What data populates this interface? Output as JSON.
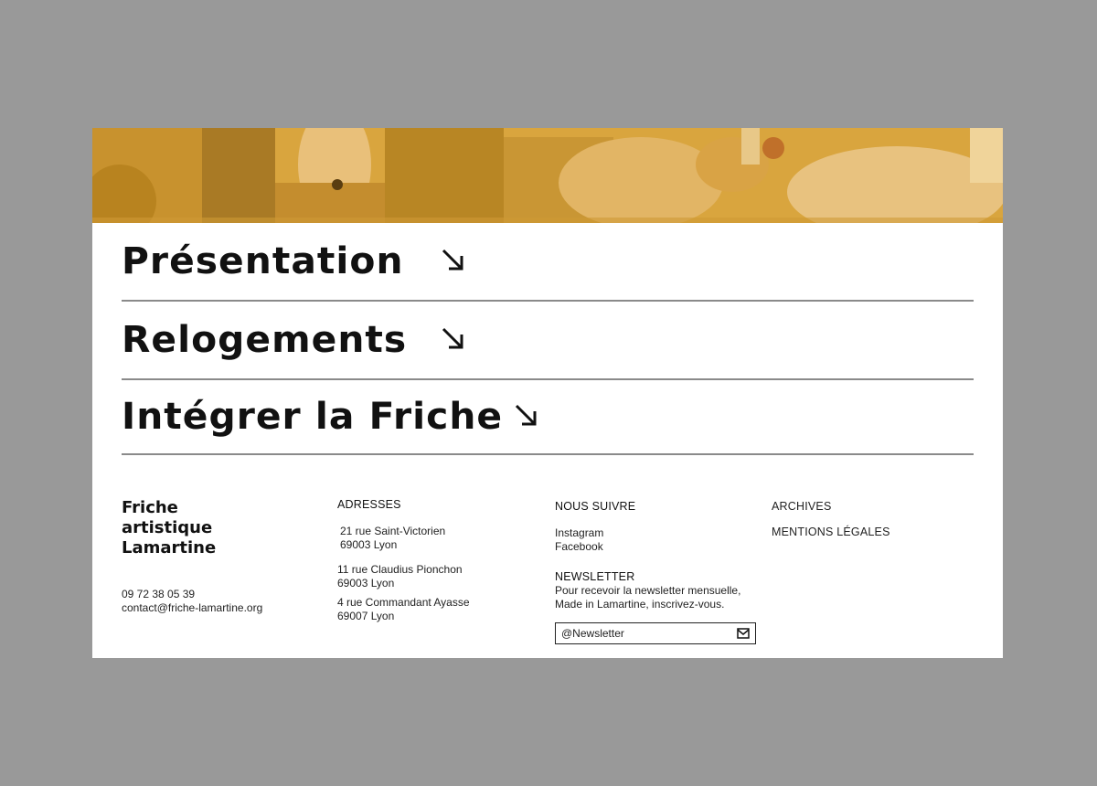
{
  "colors": {
    "page_background": "#999999",
    "panel_background": "#ffffff",
    "hero_tint": "#d8a33a",
    "text": "#111111",
    "divider": "#8a8a8a"
  },
  "menu": {
    "items": [
      {
        "label": "Présentation",
        "icon": "arrow-down-right-icon"
      },
      {
        "label": "Relogements",
        "icon": "arrow-down-right-icon"
      },
      {
        "label": "Intégrer la Friche",
        "icon": "arrow-down-right-icon"
      }
    ]
  },
  "footer": {
    "logo_lines": [
      "Friche",
      "artistique",
      "Lamartine"
    ],
    "phone": "09 72 38 05 39",
    "email": "contact@friche-lamartine.org",
    "addresses": {
      "title": "ADRESSES",
      "items": [
        {
          "line1": "21 rue Saint-Victorien",
          "line2": "69003 Lyon"
        },
        {
          "line1": "11 rue Claudius Pionchon",
          "line2": "69003 Lyon"
        },
        {
          "line1": "4 rue Commandant Ayasse",
          "line2": "69007 Lyon"
        }
      ]
    },
    "follow": {
      "title": "NOUS SUIVRE",
      "links": [
        "Instagram",
        "Facebook"
      ]
    },
    "newsletter": {
      "title": "NEWSLETTER",
      "text_line1": "Pour recevoir la newsletter mensuelle,",
      "text_line2": "Made in Lamartine, inscrivez-vous.",
      "placeholder": "@Newsletter",
      "icon": "mail-icon"
    },
    "archives": {
      "label": "ARCHIVES"
    },
    "legal": {
      "label": "MENTIONS LÉGALES"
    }
  }
}
